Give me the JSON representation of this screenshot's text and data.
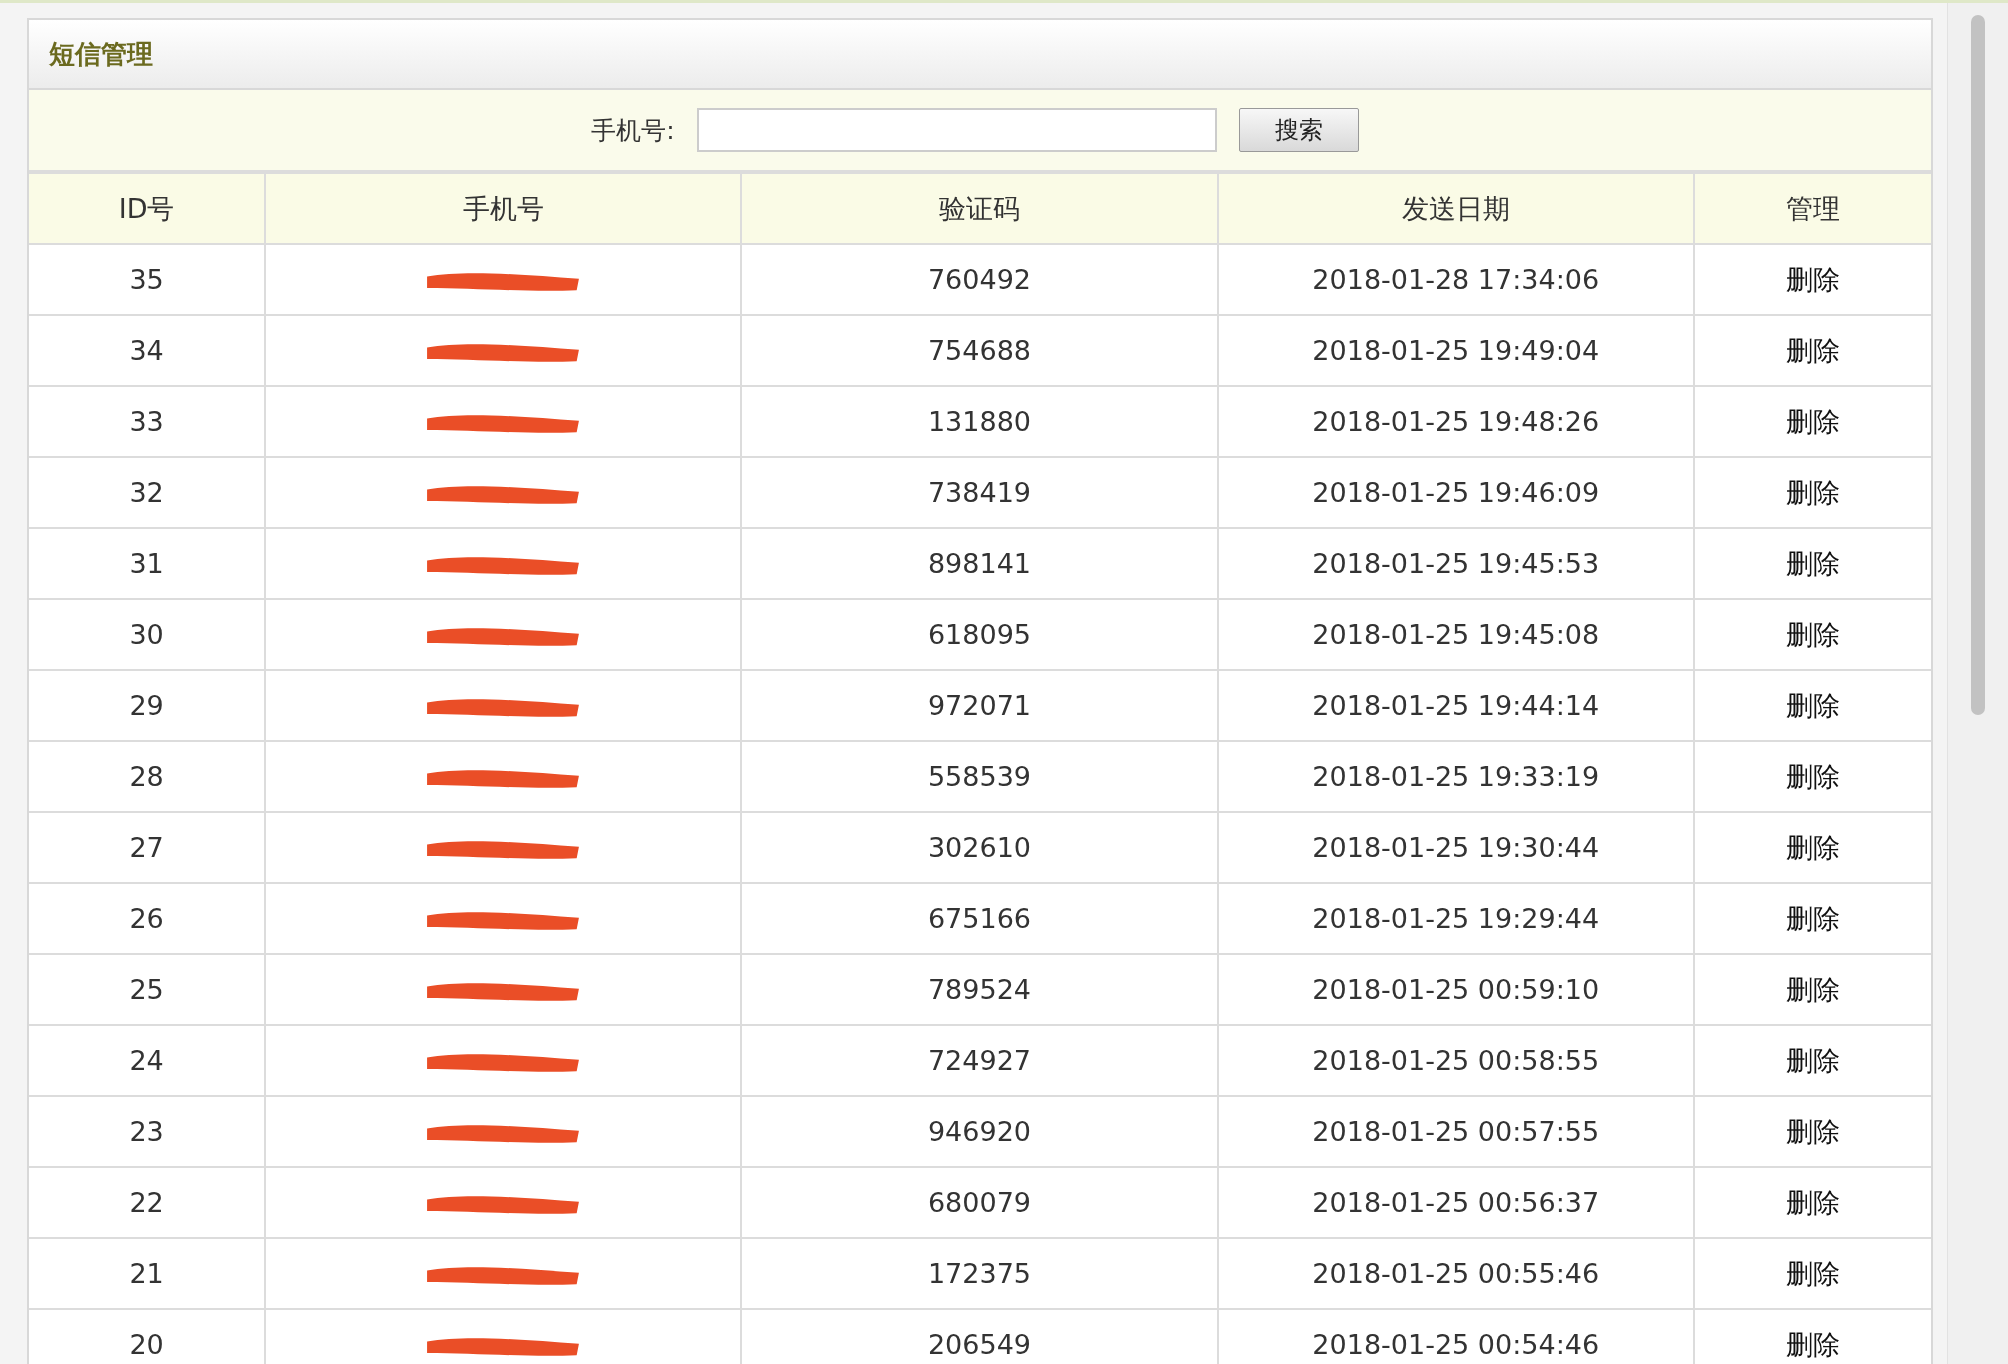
{
  "panel": {
    "title": "短信管理"
  },
  "search": {
    "label": "手机号:",
    "button": "搜索"
  },
  "table": {
    "columns": [
      "ID号",
      "手机号",
      "验证码",
      "发送日期",
      "管理"
    ],
    "rows": [
      {
        "id": "35",
        "phone_redacted": true,
        "code": "760492",
        "date": "2018-01-28 17:34:06",
        "action": "删除"
      },
      {
        "id": "34",
        "phone_redacted": true,
        "code": "754688",
        "date": "2018-01-25 19:49:04",
        "action": "删除"
      },
      {
        "id": "33",
        "phone_redacted": true,
        "code": "131880",
        "date": "2018-01-25 19:48:26",
        "action": "删除"
      },
      {
        "id": "32",
        "phone_redacted": true,
        "code": "738419",
        "date": "2018-01-25 19:46:09",
        "action": "删除"
      },
      {
        "id": "31",
        "phone_redacted": true,
        "code": "898141",
        "date": "2018-01-25 19:45:53",
        "action": "删除"
      },
      {
        "id": "30",
        "phone_redacted": true,
        "code": "618095",
        "date": "2018-01-25 19:45:08",
        "action": "删除"
      },
      {
        "id": "29",
        "phone_redacted": true,
        "code": "972071",
        "date": "2018-01-25 19:44:14",
        "action": "删除"
      },
      {
        "id": "28",
        "phone_redacted": true,
        "code": "558539",
        "date": "2018-01-25 19:33:19",
        "action": "删除"
      },
      {
        "id": "27",
        "phone_redacted": true,
        "code": "302610",
        "date": "2018-01-25 19:30:44",
        "action": "删除"
      },
      {
        "id": "26",
        "phone_redacted": true,
        "code": "675166",
        "date": "2018-01-25 19:29:44",
        "action": "删除"
      },
      {
        "id": "25",
        "phone_redacted": true,
        "code": "789524",
        "date": "2018-01-25 00:59:10",
        "action": "删除"
      },
      {
        "id": "24",
        "phone_redacted": true,
        "code": "724927",
        "date": "2018-01-25 00:58:55",
        "action": "删除"
      },
      {
        "id": "23",
        "phone_redacted": true,
        "code": "946920",
        "date": "2018-01-25 00:57:55",
        "action": "删除"
      },
      {
        "id": "22",
        "phone_redacted": true,
        "code": "680079",
        "date": "2018-01-25 00:56:37",
        "action": "删除"
      },
      {
        "id": "21",
        "phone_redacted": true,
        "code": "172375",
        "date": "2018-01-25 00:55:46",
        "action": "删除"
      },
      {
        "id": "20",
        "phone_redacted": true,
        "code": "206549",
        "date": "2018-01-25 00:54:46",
        "action": "删除"
      }
    ]
  }
}
